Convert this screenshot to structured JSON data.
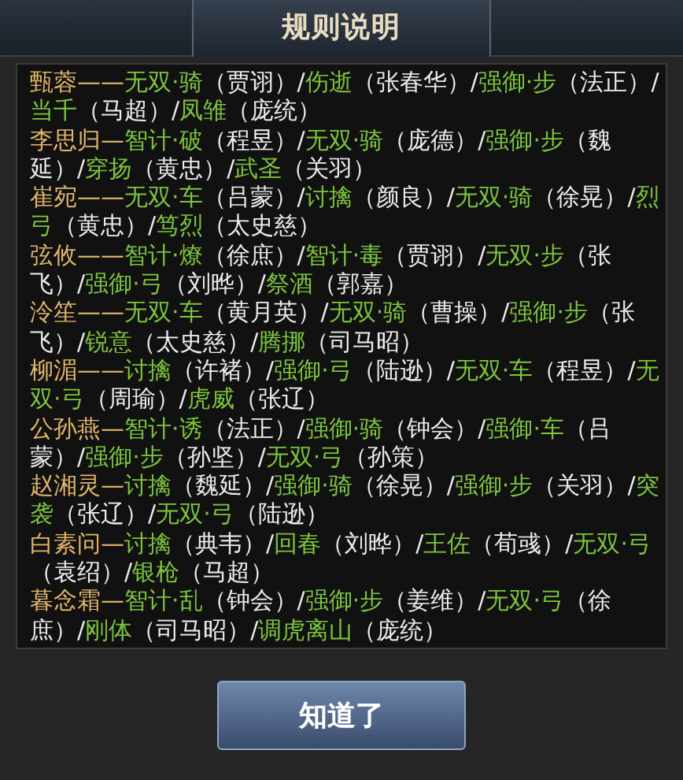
{
  "title": "规则说明",
  "entries": [
    {
      "segments": [
        {
          "kind": "name",
          "text": "甄蓉——"
        },
        {
          "kind": "skill",
          "text": "无双·骑"
        },
        {
          "kind": "plain",
          "text": "（贾诩）/"
        },
        {
          "kind": "skill",
          "text": "伤逝"
        },
        {
          "kind": "plain",
          "text": "（张春华）/"
        },
        {
          "kind": "skill",
          "text": "强御·步"
        },
        {
          "kind": "plain",
          "text": "（法正）/"
        },
        {
          "kind": "skill",
          "text": "当千"
        },
        {
          "kind": "plain",
          "text": "（马超）/"
        },
        {
          "kind": "skill",
          "text": "凤雏"
        },
        {
          "kind": "plain",
          "text": "（庞统）"
        }
      ]
    },
    {
      "segments": [
        {
          "kind": "name",
          "text": "李思归—"
        },
        {
          "kind": "skill",
          "text": "智计·破"
        },
        {
          "kind": "plain",
          "text": "（程昱）/"
        },
        {
          "kind": "skill",
          "text": "无双·骑"
        },
        {
          "kind": "plain",
          "text": "（庞德）/"
        },
        {
          "kind": "skill",
          "text": "强御·步"
        },
        {
          "kind": "plain",
          "text": "（魏延）/"
        },
        {
          "kind": "skill",
          "text": "穿扬"
        },
        {
          "kind": "plain",
          "text": "（黄忠）/"
        },
        {
          "kind": "skill",
          "text": "武圣"
        },
        {
          "kind": "plain",
          "text": "（关羽）"
        }
      ]
    },
    {
      "segments": [
        {
          "kind": "name",
          "text": "崔宛——"
        },
        {
          "kind": "skill",
          "text": "无双·车"
        },
        {
          "kind": "plain",
          "text": "（吕蒙）/"
        },
        {
          "kind": "skill",
          "text": "讨擒"
        },
        {
          "kind": "plain",
          "text": "（颜良）/"
        },
        {
          "kind": "skill",
          "text": "无双·骑"
        },
        {
          "kind": "plain",
          "text": "（徐晃）/"
        },
        {
          "kind": "skill",
          "text": "烈弓"
        },
        {
          "kind": "plain",
          "text": "（黄忠）/"
        },
        {
          "kind": "skill",
          "text": "笃烈"
        },
        {
          "kind": "plain",
          "text": "（太史慈）"
        }
      ]
    },
    {
      "segments": [
        {
          "kind": "name",
          "text": "弦攸——"
        },
        {
          "kind": "skill",
          "text": "智计·燎"
        },
        {
          "kind": "plain",
          "text": "（徐庶）/"
        },
        {
          "kind": "skill",
          "text": "智计·毒"
        },
        {
          "kind": "plain",
          "text": "（贾诩）/"
        },
        {
          "kind": "skill",
          "text": "无双·步"
        },
        {
          "kind": "plain",
          "text": "（张飞）/"
        },
        {
          "kind": "skill",
          "text": "强御·弓"
        },
        {
          "kind": "plain",
          "text": "（刘晔）/"
        },
        {
          "kind": "skill",
          "text": "祭酒"
        },
        {
          "kind": "plain",
          "text": "（郭嘉）"
        }
      ]
    },
    {
      "segments": [
        {
          "kind": "name",
          "text": "泠笙——"
        },
        {
          "kind": "skill",
          "text": "无双·车"
        },
        {
          "kind": "plain",
          "text": "（黄月英）/"
        },
        {
          "kind": "skill",
          "text": "无双·骑"
        },
        {
          "kind": "plain",
          "text": "（曹操）/"
        },
        {
          "kind": "skill",
          "text": "强御·步"
        },
        {
          "kind": "plain",
          "text": "（张飞）/"
        },
        {
          "kind": "skill",
          "text": "锐意"
        },
        {
          "kind": "plain",
          "text": "（太史慈）/"
        },
        {
          "kind": "skill",
          "text": "腾挪"
        },
        {
          "kind": "plain",
          "text": "（司马昭）"
        }
      ]
    },
    {
      "segments": [
        {
          "kind": "name",
          "text": "柳湄——"
        },
        {
          "kind": "skill",
          "text": "讨擒"
        },
        {
          "kind": "plain",
          "text": "（许褚）/"
        },
        {
          "kind": "skill",
          "text": "强御·弓"
        },
        {
          "kind": "plain",
          "text": "（陆逊）/"
        },
        {
          "kind": "skill",
          "text": "无双·车"
        },
        {
          "kind": "plain",
          "text": "（程昱）/"
        },
        {
          "kind": "skill",
          "text": "无双·弓"
        },
        {
          "kind": "plain",
          "text": "（周瑜）/"
        },
        {
          "kind": "skill",
          "text": "虎威"
        },
        {
          "kind": "plain",
          "text": "（张辽）"
        }
      ]
    },
    {
      "segments": [
        {
          "kind": "name",
          "text": "公孙燕—"
        },
        {
          "kind": "skill",
          "text": "智计·诱"
        },
        {
          "kind": "plain",
          "text": "（法正）/"
        },
        {
          "kind": "skill",
          "text": "强御·骑"
        },
        {
          "kind": "plain",
          "text": "（钟会）/"
        },
        {
          "kind": "skill",
          "text": "强御·车"
        },
        {
          "kind": "plain",
          "text": "（吕蒙）/"
        },
        {
          "kind": "skill",
          "text": "强御·步"
        },
        {
          "kind": "plain",
          "text": "（孙坚）/"
        },
        {
          "kind": "skill",
          "text": "无双·弓"
        },
        {
          "kind": "plain",
          "text": "（孙策）"
        }
      ]
    },
    {
      "segments": [
        {
          "kind": "name",
          "text": "赵湘灵—"
        },
        {
          "kind": "skill",
          "text": "讨擒"
        },
        {
          "kind": "plain",
          "text": "（魏延）/"
        },
        {
          "kind": "skill",
          "text": "强御·骑"
        },
        {
          "kind": "plain",
          "text": "（徐晃）/"
        },
        {
          "kind": "skill",
          "text": "强御·步"
        },
        {
          "kind": "plain",
          "text": "（关羽）/"
        },
        {
          "kind": "skill",
          "text": "突袭"
        },
        {
          "kind": "plain",
          "text": "（张辽）/"
        },
        {
          "kind": "skill",
          "text": "无双·弓"
        },
        {
          "kind": "plain",
          "text": "（陆逊）"
        }
      ]
    },
    {
      "segments": [
        {
          "kind": "name",
          "text": "白素问—"
        },
        {
          "kind": "skill",
          "text": "讨擒"
        },
        {
          "kind": "plain",
          "text": "（典韦）/"
        },
        {
          "kind": "skill",
          "text": "回春"
        },
        {
          "kind": "plain",
          "text": "（刘晔）/"
        },
        {
          "kind": "skill",
          "text": "王佐"
        },
        {
          "kind": "plain",
          "text": "（荀彧）/"
        },
        {
          "kind": "skill",
          "text": "无双·弓"
        },
        {
          "kind": "plain",
          "text": "（袁绍）/"
        },
        {
          "kind": "skill",
          "text": "银枪"
        },
        {
          "kind": "plain",
          "text": "（马超）"
        }
      ]
    },
    {
      "segments": [
        {
          "kind": "name",
          "text": "暮念霜—"
        },
        {
          "kind": "skill",
          "text": "智计·乱"
        },
        {
          "kind": "plain",
          "text": "（钟会）/"
        },
        {
          "kind": "skill",
          "text": "强御·步"
        },
        {
          "kind": "plain",
          "text": "（姜维）/"
        },
        {
          "kind": "skill",
          "text": "无双·弓"
        },
        {
          "kind": "plain",
          "text": "（徐庶）/"
        },
        {
          "kind": "skill",
          "text": "刚体"
        },
        {
          "kind": "plain",
          "text": "（司马昭）/"
        },
        {
          "kind": "skill",
          "text": "调虎离山"
        },
        {
          "kind": "plain",
          "text": "（庞统）"
        }
      ]
    }
  ],
  "button": "知道了"
}
